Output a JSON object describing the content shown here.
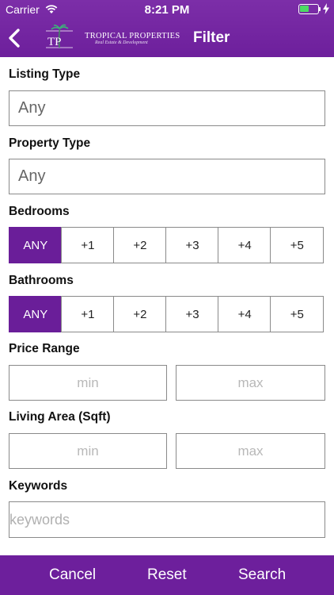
{
  "status_bar": {
    "carrier": "Carrier",
    "time": "8:21 PM",
    "battery_level": 0.5,
    "battery_color": "#4cd964"
  },
  "header": {
    "back_icon": "chevron-left-icon",
    "logo": {
      "monogram": "TP",
      "name": "TROPICAL PROPERTIES",
      "tagline": "Real Estate & Development"
    },
    "title": "Filter",
    "background_color": "#6d1f9c"
  },
  "filters": {
    "listing_type": {
      "label": "Listing Type",
      "value": "Any"
    },
    "property_type": {
      "label": "Property Type",
      "value": "Any"
    },
    "bedrooms": {
      "label": "Bedrooms",
      "options": [
        "ANY",
        "+1",
        "+2",
        "+3",
        "+4",
        "+5"
      ],
      "selected": "ANY"
    },
    "bathrooms": {
      "label": "Bathrooms",
      "options": [
        "ANY",
        "+1",
        "+2",
        "+3",
        "+4",
        "+5"
      ],
      "selected": "ANY"
    },
    "price_range": {
      "label": "Price Range",
      "min_placeholder": "min",
      "max_placeholder": "max"
    },
    "living_area": {
      "label": "Living Area (Sqft)",
      "min_placeholder": "min",
      "max_placeholder": "max"
    },
    "keywords": {
      "label": "Keywords",
      "placeholder": "keywords"
    }
  },
  "footer": {
    "cancel_label": "Cancel",
    "reset_label": "Reset",
    "search_label": "Search"
  },
  "colors": {
    "accent": "#6a1e99",
    "field_border": "#8a8a8a"
  }
}
